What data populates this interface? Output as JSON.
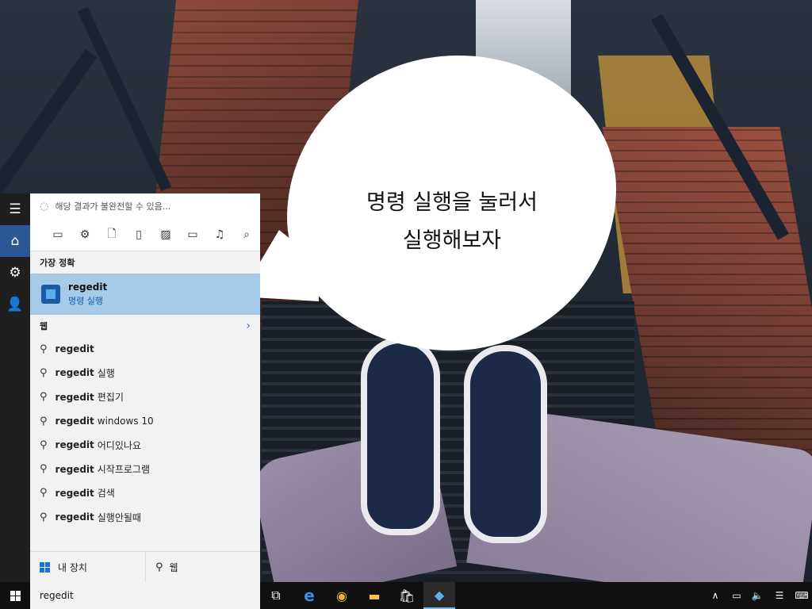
{
  "bubble": {
    "line1": "명령 실행을 눌러서",
    "line2": "실행해보자"
  },
  "start_menu": {
    "rail": [
      {
        "name": "hamburger-menu-icon",
        "glyph": "☰"
      },
      {
        "name": "home-icon",
        "glyph": "⌂"
      },
      {
        "name": "gear-icon",
        "glyph": "⚙"
      },
      {
        "name": "feedback-icon",
        "glyph": "👤"
      }
    ],
    "notice": "해당 결과가 불완전할 수 있음...",
    "filters": [
      {
        "name": "apps-filter-icon",
        "glyph": "▭"
      },
      {
        "name": "settings-filter-icon",
        "glyph": "⚙"
      },
      {
        "name": "documents-filter-icon",
        "glyph": "🗋"
      },
      {
        "name": "folders-filter-icon",
        "glyph": "▯"
      },
      {
        "name": "photos-filter-icon",
        "glyph": "▨"
      },
      {
        "name": "videos-filter-icon",
        "glyph": "▭"
      },
      {
        "name": "music-filter-icon",
        "glyph": "♫"
      },
      {
        "name": "web-filter-icon",
        "glyph": "⌕"
      }
    ],
    "best_match_header": "가장 정확",
    "best_match": {
      "title": "regedit",
      "subtitle": "명령 실행"
    },
    "web_header": "웹",
    "suggestions": [
      {
        "query": "regedit",
        "rest": ""
      },
      {
        "query": "regedit",
        "rest": "실행"
      },
      {
        "query": "regedit",
        "rest": "편집기"
      },
      {
        "query": "regedit",
        "rest": "windows 10"
      },
      {
        "query": "regedit",
        "rest": "어디있나요"
      },
      {
        "query": "regedit",
        "rest": "시작프로그램"
      },
      {
        "query": "regedit",
        "rest": "검색"
      },
      {
        "query": "regedit",
        "rest": "실행안될때"
      }
    ],
    "bottom": {
      "my_stuff": "내 장치",
      "web": "웹"
    }
  },
  "taskbar": {
    "search_value": "regedit",
    "apps": [
      {
        "name": "task-view-icon",
        "glyph": "⧉",
        "color": "#ffffff"
      },
      {
        "name": "edge-icon",
        "glyph": "e",
        "color": "#3c8ee6"
      },
      {
        "name": "chrome-icon",
        "glyph": "◉",
        "color": "#e8b62f"
      },
      {
        "name": "file-explorer-icon",
        "glyph": "▬",
        "color": "#f2c44e"
      },
      {
        "name": "store-icon",
        "glyph": "🛍",
        "color": "#ffffff"
      },
      {
        "name": "regedit-icon",
        "glyph": "◆",
        "color": "#5ab1ec"
      }
    ],
    "tray": [
      {
        "name": "chevron-up-icon",
        "glyph": "∧"
      },
      {
        "name": "battery-icon",
        "glyph": "▭"
      },
      {
        "name": "volume-icon",
        "glyph": "🔈"
      },
      {
        "name": "action-center-icon",
        "glyph": "☰"
      },
      {
        "name": "keyboard-icon",
        "glyph": "⌨"
      }
    ]
  }
}
